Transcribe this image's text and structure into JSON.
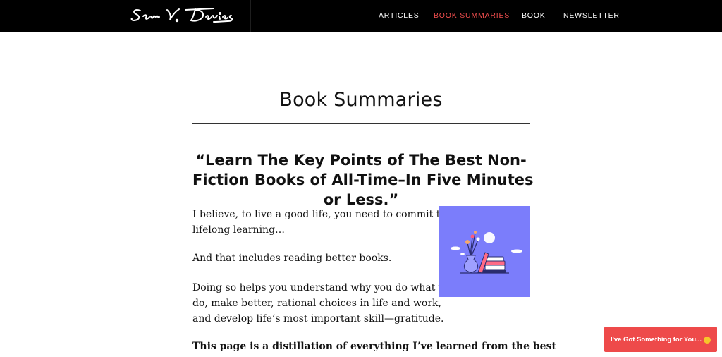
{
  "header": {
    "logo_alt": "Sam V. Davies",
    "nav": [
      {
        "label": "ARTICLES"
      },
      {
        "label": "BOOK SUMMARIES"
      },
      {
        "label": "BOOK"
      },
      {
        "label": "NEWSLETTER"
      }
    ],
    "active_color": "#ee4d4d",
    "bar_color": "#000000"
  },
  "main": {
    "title": "Book Summaries",
    "headline": [
      "“Learn The Key Points of The Best Non-",
      "Fiction Books of All-Time–In Five Minutes",
      "or Less.”"
    ],
    "paragraphs": [
      [
        "I believe, to live a good life, you need to commit to",
        "lifelong learning…"
      ],
      [
        "And that includes reading better books."
      ],
      [
        "Doing so helps you understand why you do what you",
        "do, make better, rational choices in life and work,",
        "and develop life’s most important skill—gratitude."
      ]
    ],
    "bold_paragraph": "This page is a distillation of everything I’ve learned from the best",
    "illustration": {
      "icon": "books-vase-illustration",
      "bg_color": "#7b7dfb"
    }
  },
  "promo": {
    "label": "I've Got Something for You...",
    "icon": "smile-emoji-icon",
    "color": "#ee4a4a"
  }
}
